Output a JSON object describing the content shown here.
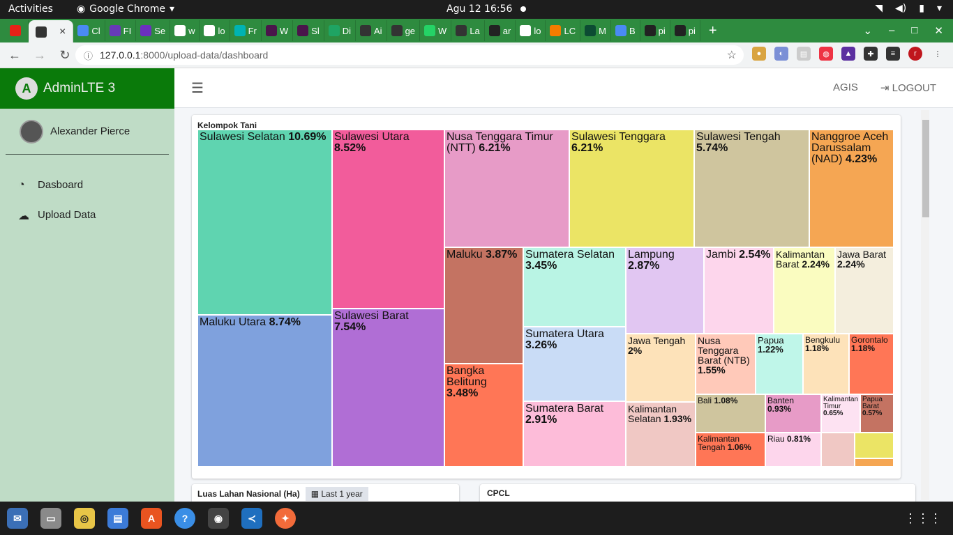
{
  "system": {
    "activities": "Activities",
    "app_name": "Google Chrome",
    "clock": "Agu 12  16:56"
  },
  "browser": {
    "tabs": [
      {
        "favicon": "youtube-icon",
        "color": "#e62117"
      },
      {
        "favicon": "chrome-icon",
        "color": "#333"
      },
      {
        "label": "Cl",
        "favicon": "flag-icon",
        "color": "#4a8af4"
      },
      {
        "label": "FI",
        "favicon": "forms-icon",
        "color": "#673ab7"
      },
      {
        "label": "Se",
        "favicon": "se-icon",
        "color": "#6b2fbf"
      },
      {
        "label": "w",
        "favicon": "google-icon",
        "color": "#fff"
      },
      {
        "label": "lo",
        "favicon": "google-icon",
        "color": "#fff"
      },
      {
        "label": "Fr",
        "favicon": "fr-icon",
        "color": "#00b3b3"
      },
      {
        "label": "W",
        "favicon": "slack-icon",
        "color": "#4a154b"
      },
      {
        "label": "Sl",
        "favicon": "slack-icon",
        "color": "#4a154b"
      },
      {
        "label": "Di",
        "favicon": "drive-icon",
        "color": "#1fa463"
      },
      {
        "label": "Ai",
        "favicon": "chrome-icon",
        "color": "#333"
      },
      {
        "label": "ge",
        "favicon": "chrome-icon",
        "color": "#333"
      },
      {
        "label": "W",
        "favicon": "whatsapp-icon",
        "color": "#25d366"
      },
      {
        "label": "La",
        "favicon": "chrome-icon",
        "color": "#333"
      },
      {
        "label": "ar",
        "favicon": "github-icon",
        "color": "#222"
      },
      {
        "label": "lo",
        "favicon": "google-icon",
        "color": "#fff"
      },
      {
        "label": "LC",
        "favicon": "blogger-icon",
        "color": "#f57c00"
      },
      {
        "label": "M",
        "favicon": "django-icon",
        "color": "#0c4b33"
      },
      {
        "label": "B",
        "favicon": "b-icon",
        "color": "#4a8af4"
      },
      {
        "label": "pi",
        "favicon": "github-icon",
        "color": "#222"
      },
      {
        "label": "pi",
        "favicon": "github-icon",
        "color": "#222"
      }
    ],
    "url_host": "127.0.0.1",
    "url_path": ":8000/upload-data/dashboard"
  },
  "sidebar": {
    "brand": "AdminLTE 3",
    "user_name": "Alexander Pierce",
    "items": [
      {
        "label": "Dasboard",
        "icon": "dashboard-icon"
      },
      {
        "label": "Upload Data",
        "icon": "cloud-upload-icon"
      }
    ]
  },
  "navbar": {
    "link_agis": "AGIS",
    "link_logout": "LOGOUT"
  },
  "card_tree": {
    "title": "Kelompok Tani"
  },
  "card_luas": {
    "title": "Luas Lahan Nasional (Ha)",
    "range_label": "Last 1 year"
  },
  "card_cpcl": {
    "title": "CPCL"
  },
  "chart_data": {
    "type": "treemap",
    "title": "Kelompok Tani",
    "items": [
      {
        "name": "Sulawesi Selatan",
        "value": "10.69%",
        "color": "#5fd4b0"
      },
      {
        "name": "Maluku Utara",
        "value": "8.74%",
        "color": "#7fa1dd"
      },
      {
        "name": "Sulawesi Utara",
        "value": "8.52%",
        "color": "#f25c9b"
      },
      {
        "name": "Sulawesi Barat",
        "value": "7.54%",
        "color": "#b06ed5"
      },
      {
        "name": "Nusa Tenggara Timur (NTT)",
        "value": "6.21%",
        "color": "#e79bc7"
      },
      {
        "name": "Sulawesi Tenggara",
        "value": "6.21%",
        "color": "#ebe465"
      },
      {
        "name": "Sulawesi Tengah",
        "value": "5.74%",
        "color": "#cfc59e"
      },
      {
        "name": "Nanggroe Aceh Darussalam (NAD)",
        "value": "4.23%",
        "color": "#f5a653"
      },
      {
        "name": "Maluku",
        "value": "3.87%",
        "color": "#c47362"
      },
      {
        "name": "Bangka Belitung",
        "value": "3.48%",
        "color": "#ff7656"
      },
      {
        "name": "Sumatera Selatan",
        "value": "3.45%",
        "color": "#b9f4e4"
      },
      {
        "name": "Sumatera Utara",
        "value": "3.26%",
        "color": "#c9dcf6"
      },
      {
        "name": "Sumatera Barat",
        "value": "2.91%",
        "color": "#fdbcd9"
      },
      {
        "name": "Lampung",
        "value": "2.87%",
        "color": "#e1c6f2"
      },
      {
        "name": "Jambi",
        "value": "2.54%",
        "color": "#fdd6ec"
      },
      {
        "name": "Kalimantan Barat",
        "value": "2.24%",
        "color": "#fafcc0"
      },
      {
        "name": "Jawa Barat",
        "value": "2.24%",
        "color": "#f4eedd"
      },
      {
        "name": "Jawa Tengah",
        "value": "2%",
        "color": "#fde2b9"
      },
      {
        "name": "Kalimantan Selatan",
        "value": "1.93%",
        "color": "#f0c8c4"
      },
      {
        "name": "Nusa Tenggara Barat (NTB)",
        "value": "1.55%",
        "color": "#ffc9b9"
      },
      {
        "name": "Papua",
        "value": "1.22%",
        "color": "#bff6e9"
      },
      {
        "name": "Bengkulu",
        "value": "1.18%",
        "color": "#fde2b9"
      },
      {
        "name": "Gorontalo",
        "value": "1.18%",
        "color": "#ff7656"
      },
      {
        "name": "Bali",
        "value": "1.08%",
        "color": "#cfc59e"
      },
      {
        "name": "Banten",
        "value": "0.93%",
        "color": "#e79bc7"
      },
      {
        "name": "Kalimantan Timur",
        "value": "0.65%",
        "color": "#fde2f2"
      },
      {
        "name": "Papua Barat",
        "value": "0.57%",
        "color": "#c47362"
      },
      {
        "name": "Kalimantan Tengah",
        "value": "1.06%",
        "color": "#ff7656"
      },
      {
        "name": "Riau",
        "value": "0.81%",
        "color": "#fdd6ec"
      },
      {
        "name": "",
        "value": "",
        "color": "#f0c8c4"
      },
      {
        "name": "",
        "value": "",
        "color": "#ebe465"
      },
      {
        "name": "",
        "value": "",
        "color": "#f5a653"
      }
    ]
  }
}
